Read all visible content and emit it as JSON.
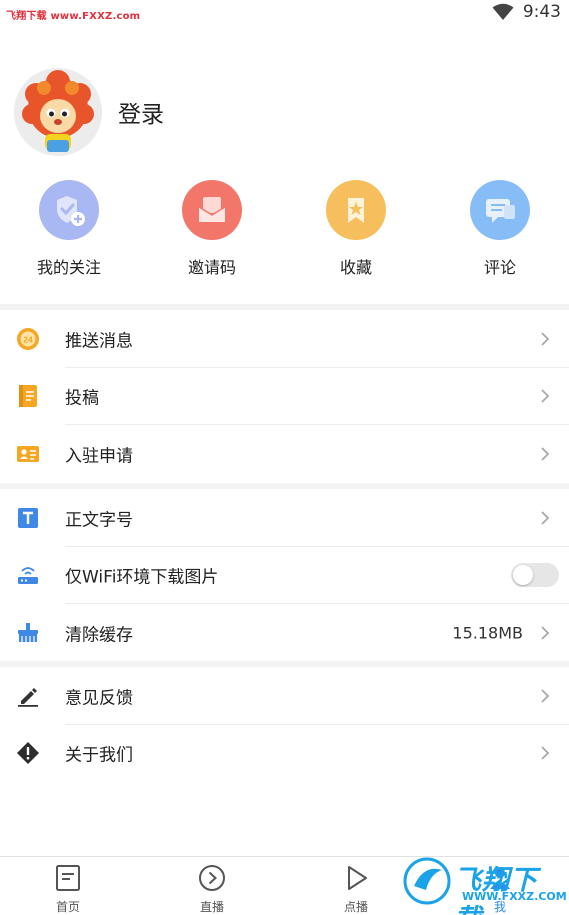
{
  "status_bar": {
    "watermark_text": "飞翔下载 www.FXXZ.com",
    "time": "9:43",
    "wifi_icon": "wifi-icon",
    "battery_icon": "battery-icon"
  },
  "profile": {
    "avatar_icon": "lion-mascot-avatar",
    "login_label": "登录"
  },
  "quick_actions": [
    {
      "label": "我的关注",
      "icon": "follow-badge-icon",
      "color": "#a9b7f2"
    },
    {
      "label": "邀请码",
      "icon": "invite-mail-icon",
      "color": "#f2766a"
    },
    {
      "label": "收藏",
      "icon": "bookmark-icon",
      "color": "#f6be5c"
    },
    {
      "label": "评论",
      "icon": "comment-icon",
      "color": "#86bdf6"
    }
  ],
  "menu_group_1": [
    {
      "label": "推送消息",
      "icon": "push-24-icon"
    },
    {
      "label": "投稿",
      "icon": "document-icon"
    },
    {
      "label": "入驻申请",
      "icon": "id-card-icon"
    }
  ],
  "menu_group_2": [
    {
      "label": "正文字号",
      "icon": "text-size-icon"
    },
    {
      "label": "仅WiFi环境下载图片",
      "icon": "router-icon",
      "toggle_on": false
    },
    {
      "label": "清除缓存",
      "icon": "broom-icon",
      "value": "15.18MB"
    }
  ],
  "menu_group_3": [
    {
      "label": "意见反馈",
      "icon": "pencil-icon"
    },
    {
      "label": "关于我们",
      "icon": "info-diamond-icon"
    }
  ],
  "bottom_nav": [
    {
      "label": "首页",
      "icon": "home-doc-icon"
    },
    {
      "label": "直播",
      "icon": "live-play-circle-icon"
    },
    {
      "label": "点播",
      "icon": "play-triangle-icon"
    },
    {
      "label": "我",
      "icon": "me-icon",
      "active": true
    }
  ],
  "watermark": {
    "brand": "飞翔下载",
    "url": "WWW.FXXZ.COM"
  },
  "colors": {
    "accent": "#2b8df0",
    "orange": "#f5a623",
    "blue_icon": "#3f88e6"
  }
}
